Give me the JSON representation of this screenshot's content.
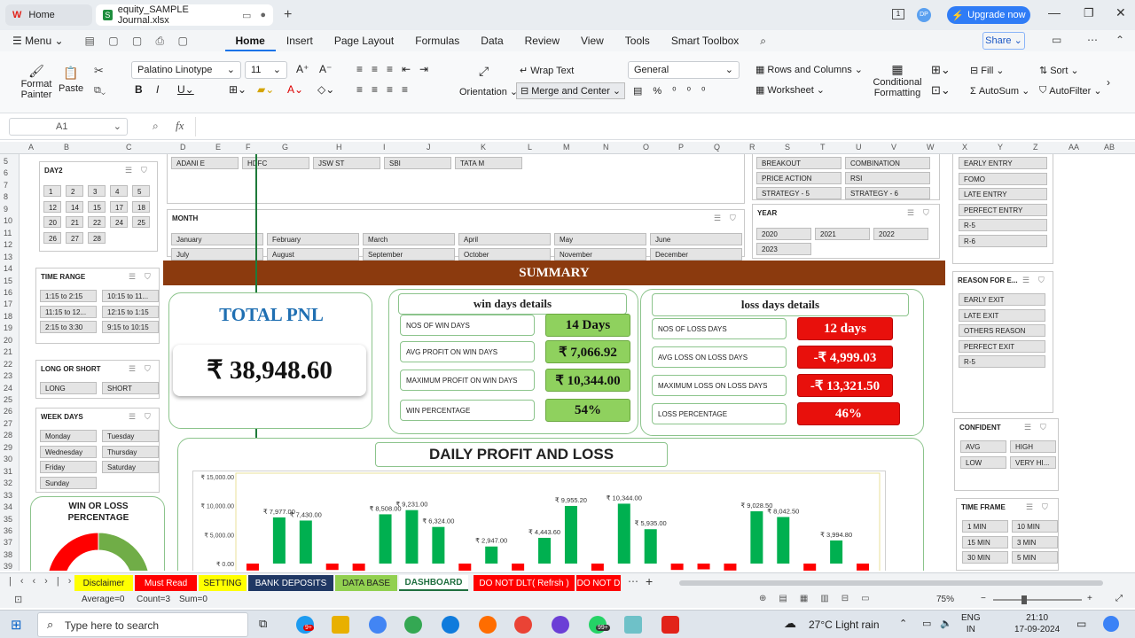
{
  "titlebar": {
    "home_tab": "Home",
    "file_tab": "equity_SAMPLE Journal.xlsx",
    "avatar": "DP",
    "upgrade": "Upgrade now"
  },
  "menu": {
    "menu_label": "Menu",
    "items": [
      "Home",
      "Insert",
      "Page Layout",
      "Formulas",
      "Data",
      "Review",
      "View",
      "Tools",
      "Smart Toolbox"
    ],
    "share": "Share"
  },
  "ribbon": {
    "format_painter": "Format Painter",
    "paste": "Paste",
    "font": "Palatino Linotype",
    "font_size": "11",
    "wrap_text": "Wrap Text",
    "orientation": "Orientation",
    "merge_center": "Merge and Center",
    "number_format": "General",
    "rows_columns": "Rows and Columns",
    "worksheet": "Worksheet",
    "conditional": "Conditional Formatting",
    "fill": "Fill",
    "sort": "Sort",
    "autosum": "AutoSum",
    "autofilter": "AutoFilter"
  },
  "formula": {
    "cell_ref": "A1",
    "fx": "fx"
  },
  "columns": [
    "A",
    "B",
    "C",
    "D",
    "E",
    "F",
    "G",
    "H",
    "I",
    "J",
    "K",
    "L",
    "M",
    "N",
    "O",
    "P",
    "Q",
    "R",
    "S",
    "T",
    "U",
    "V",
    "W",
    "X",
    "Y",
    "Z",
    "AA",
    "AB"
  ],
  "rows": [
    "5",
    "6",
    "7",
    "8",
    "9",
    "10",
    "11",
    "12",
    "13",
    "14",
    "15",
    "16",
    "17",
    "18",
    "19",
    "20",
    "21",
    "22",
    "23",
    "24",
    "25",
    "26",
    "27",
    "28",
    "29",
    "30",
    "31",
    "32",
    "33",
    "34",
    "35",
    "36",
    "37",
    "38",
    "39"
  ],
  "slicers": {
    "day2": {
      "title": "DAY2",
      "items": [
        "1",
        "2",
        "3",
        "4",
        "5",
        "12",
        "14",
        "15",
        "17",
        "18",
        "20",
        "21",
        "22",
        "24",
        "25",
        "26",
        "27",
        "28"
      ]
    },
    "stocks": {
      "items": [
        "ADANI E",
        "HDFC",
        "JSW ST",
        "SBI",
        "TATA M"
      ]
    },
    "strategy": {
      "items": [
        "BREAKOUT",
        "COMBINATION",
        "PRICE ACTION",
        "RSI",
        "STRATEGY - 5",
        "STRATEGY - 6"
      ]
    },
    "entry": {
      "items": [
        "EARLY ENTRY",
        "FOMO",
        "LATE ENTRY",
        "PERFECT ENTRY",
        "R-5",
        "R-6"
      ]
    },
    "month": {
      "title": "MONTH",
      "items": [
        "January",
        "February",
        "March",
        "April",
        "May",
        "June",
        "July",
        "August",
        "September",
        "October",
        "November",
        "December"
      ]
    },
    "year": {
      "title": "YEAR",
      "items": [
        "2020",
        "2021",
        "2022",
        "2023"
      ]
    },
    "time_range": {
      "title": "TIME RANGE",
      "items": [
        "1:15 to 2:15",
        "10:15 to 11...",
        "11:15 to 12...",
        "12:15 to 1:15",
        "2:15 to 3:30",
        "9:15 to 10:15"
      ]
    },
    "reason": {
      "title": "REASON FOR E...",
      "items": [
        "EARLY EXIT",
        "LATE EXIT",
        "OTHERS REASON",
        "PERFECT EXIT",
        "R-5"
      ]
    },
    "long_short": {
      "title": "LONG OR SHORT",
      "items": [
        "LONG",
        "SHORT"
      ]
    },
    "week_days": {
      "title": "WEEK DAYS",
      "items": [
        "Monday",
        "Tuesday",
        "Wednesday",
        "Thursday",
        "Friday",
        "Saturday",
        "Sunday"
      ]
    },
    "confident": {
      "title": "CONFIDENT",
      "items": [
        "AVG",
        "HIGH",
        "LOW",
        "VERY HI..."
      ]
    },
    "time_frame": {
      "title": "TIME FRAME",
      "items": [
        "1 MIN",
        "10 MIN",
        "15 MIN",
        "3 MIN",
        "30 MIN",
        "5 MIN"
      ]
    }
  },
  "summary": {
    "title": "SUMMARY",
    "total_pnl_label": "TOTAL PNL",
    "total_pnl_value": "₹ 38,948.60",
    "win": {
      "title": "win days details",
      "rows": [
        {
          "label": "NOS OF WIN DAYS",
          "value": "14 Days"
        },
        {
          "label": "AVG PROFIT ON WIN DAYS",
          "value": "₹ 7,066.92"
        },
        {
          "label": "MAXIMUM PROFIT ON WIN DAYS",
          "value": "₹ 10,344.00"
        },
        {
          "label": "WIN PERCENTAGE",
          "value": "54%"
        }
      ]
    },
    "loss": {
      "title": "loss days details",
      "rows": [
        {
          "label": "NOS OF LOSS DAYS",
          "value": "12  days"
        },
        {
          "label": "AVG LOSS ON LOSS DAYS",
          "value": "-₹ 4,999.03"
        },
        {
          "label": "MAXIMUM LOSS ON LOSS DAYS",
          "value": "-₹ 13,321.50"
        },
        {
          "label": "LOSS PERCENTAGE",
          "value": "46%"
        }
      ]
    }
  },
  "win_loss_chart": {
    "title": "WIN OR LOSS PERCENTAGE",
    "win_pct": 54,
    "loss_pct": 46,
    "win_color": "#70ad47",
    "loss_color": "#ff0000"
  },
  "chart_data": {
    "type": "bar",
    "title": "DAILY PROFIT AND LOSS",
    "ylim": [
      0,
      15000
    ],
    "yticks": [
      "₹ 15,000.00",
      "₹ 10,000.00",
      "₹ 5,000.00",
      "₹ 0.00"
    ],
    "values": [
      -1200,
      7977,
      7430,
      -1100,
      -1300,
      8508,
      9231,
      6324,
      -1400,
      2947,
      -1200,
      4443.6,
      9955.2,
      -1300,
      10344,
      5935,
      -1100,
      -1000,
      -1200,
      9028.5,
      8042.5,
      -1300,
      3994.8,
      -1200
    ],
    "labels": [
      "",
      "₹ 7,977.00",
      "₹ 7,430.00",
      "",
      "",
      "₹ 8,508.00",
      "₹ 9,231.00",
      "₹ 6,324.00",
      "",
      "₹ 2,947.00",
      "",
      "₹ 4,443.60",
      "₹ 9,955.20",
      "",
      "₹ 10,344.00",
      "₹ 5,935.00",
      "",
      "",
      "",
      "₹ 9,028.50",
      "₹ 8,042.50",
      "",
      "₹ 3,994.80",
      ""
    ],
    "pos_color": "#00b050",
    "neg_color": "#ff0000"
  },
  "sheet_tabs": [
    {
      "label": "Disclaimer",
      "bg": "#ffff00",
      "fg": "#222"
    },
    {
      "label": "Must Read",
      "bg": "#ff0000",
      "fg": "#fff"
    },
    {
      "label": "SETTING",
      "bg": "#ffff00",
      "fg": "#222"
    },
    {
      "label": "BANK DEPOSITS",
      "bg": "#203864",
      "fg": "#fff"
    },
    {
      "label": "DATA BASE",
      "bg": "#92d050",
      "fg": "#222"
    },
    {
      "label": "DASHBOARD",
      "bg": "#ffffff",
      "fg": "#1f6f3f"
    },
    {
      "label": "DO NOT DLT( Refrsh )",
      "bg": "#ff0000",
      "fg": "#fff"
    },
    {
      "label": "DO NOT D",
      "bg": "#ff0000",
      "fg": "#fff"
    }
  ],
  "status": {
    "average": "Average=0",
    "count": "Count=3",
    "sum": "Sum=0",
    "zoom": "75%"
  },
  "taskbar": {
    "search": "Type here to search",
    "badge1": "9+",
    "badge2": "99+",
    "weather": "27°C  Light rain",
    "lang1": "ENG",
    "lang2": "IN",
    "time": "21:10",
    "date": "17-09-2024"
  }
}
